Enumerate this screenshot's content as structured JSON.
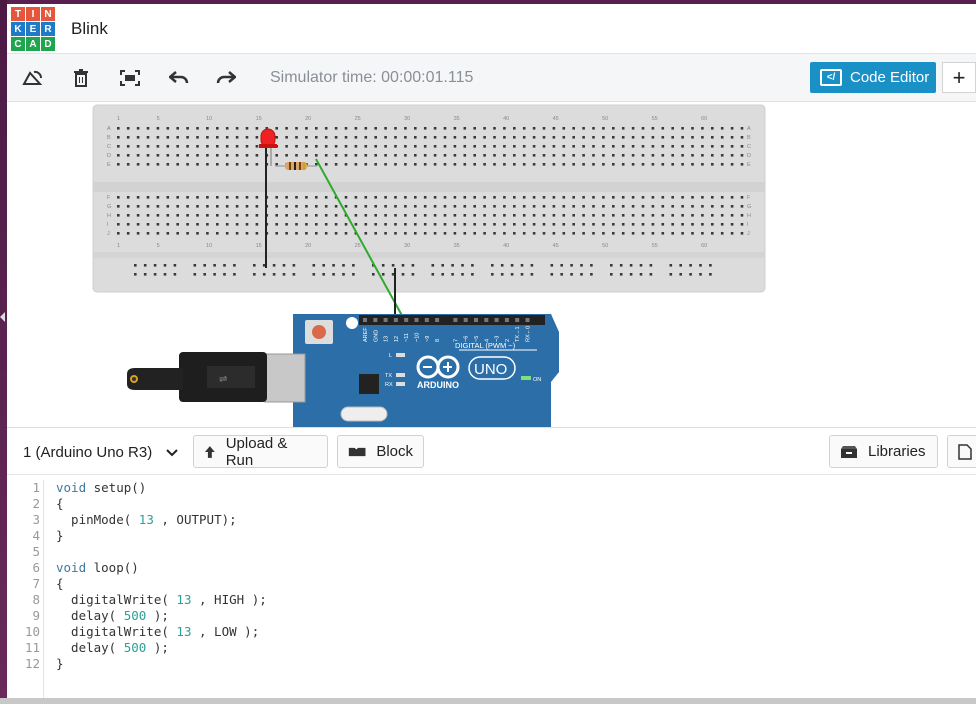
{
  "header": {
    "logo_letters": [
      "T",
      "I",
      "N",
      "K",
      "E",
      "R",
      "C",
      "A",
      "D"
    ],
    "logo_colors": [
      "#e4573d",
      "#e4573d",
      "#e4573d",
      "#1f7ac8",
      "#1f7ac8",
      "#1f7ac8",
      "#1fa54d",
      "#1fa54d",
      "#1fa54d"
    ],
    "title": "Blink"
  },
  "toolbar": {
    "icons": [
      "rotate-icon",
      "delete-icon",
      "fit-view-icon",
      "undo-icon",
      "redo-icon"
    ],
    "sim_time": "Simulator time: 00:00:01.115",
    "code_editor_label": "Code Editor",
    "plus": "+"
  },
  "canvas": {
    "breadboard_top_numbers": [
      "1",
      "5",
      "10",
      "15",
      "20",
      "25",
      "30",
      "35",
      "40",
      "45",
      "50",
      "55",
      "60"
    ],
    "breadboard_row_letters_top": [
      "A",
      "B",
      "C",
      "D",
      "E"
    ],
    "breadboard_row_letters_bottom": [
      "F",
      "G",
      "H",
      "I",
      "J"
    ],
    "arduino": {
      "brand": "ARDUINO",
      "model": "UNO",
      "header_label": "DIGITAL (PWM ~)",
      "pin_labels": [
        "AREF",
        "GND",
        "13",
        "12",
        "~11",
        "~10",
        "~9",
        "8",
        "7",
        "~6",
        "~5",
        "4",
        "~3",
        "2",
        "TX→1",
        "RX←0"
      ],
      "led_labels": [
        "L",
        "TX",
        "RX",
        "ON"
      ]
    }
  },
  "code_panel": {
    "device_select": "1 (Arduino Uno R3)",
    "upload_run_label": "Upload & Run",
    "block_label": "Block",
    "libraries_label": "Libraries"
  },
  "code": {
    "line_numbers": [
      "1",
      "2",
      "3",
      "4",
      "5",
      "6",
      "7",
      "8",
      "9",
      "10",
      "11",
      "12"
    ],
    "lines": [
      [
        [
          "kw",
          "void"
        ],
        [
          "",
          " setup()"
        ]
      ],
      [
        [
          "",
          "{"
        ]
      ],
      [
        [
          "",
          "  pinMode( "
        ],
        [
          "num",
          "13"
        ],
        [
          "",
          " , OUTPUT);"
        ]
      ],
      [
        [
          "",
          "}"
        ]
      ],
      [
        [
          "",
          ""
        ]
      ],
      [
        [
          "kw",
          "void"
        ],
        [
          "",
          " loop()"
        ]
      ],
      [
        [
          "",
          "{"
        ]
      ],
      [
        [
          "",
          "  digitalWrite( "
        ],
        [
          "num",
          "13"
        ],
        [
          "",
          " , HIGH );"
        ]
      ],
      [
        [
          "",
          "  delay( "
        ],
        [
          "num",
          "500"
        ],
        [
          "",
          " );"
        ]
      ],
      [
        [
          "",
          "  digitalWrite( "
        ],
        [
          "num",
          "13"
        ],
        [
          "",
          " , LOW );"
        ]
      ],
      [
        [
          "",
          "  delay( "
        ],
        [
          "num",
          "500"
        ],
        [
          "",
          " );"
        ]
      ],
      [
        [
          "",
          "}"
        ]
      ]
    ]
  }
}
